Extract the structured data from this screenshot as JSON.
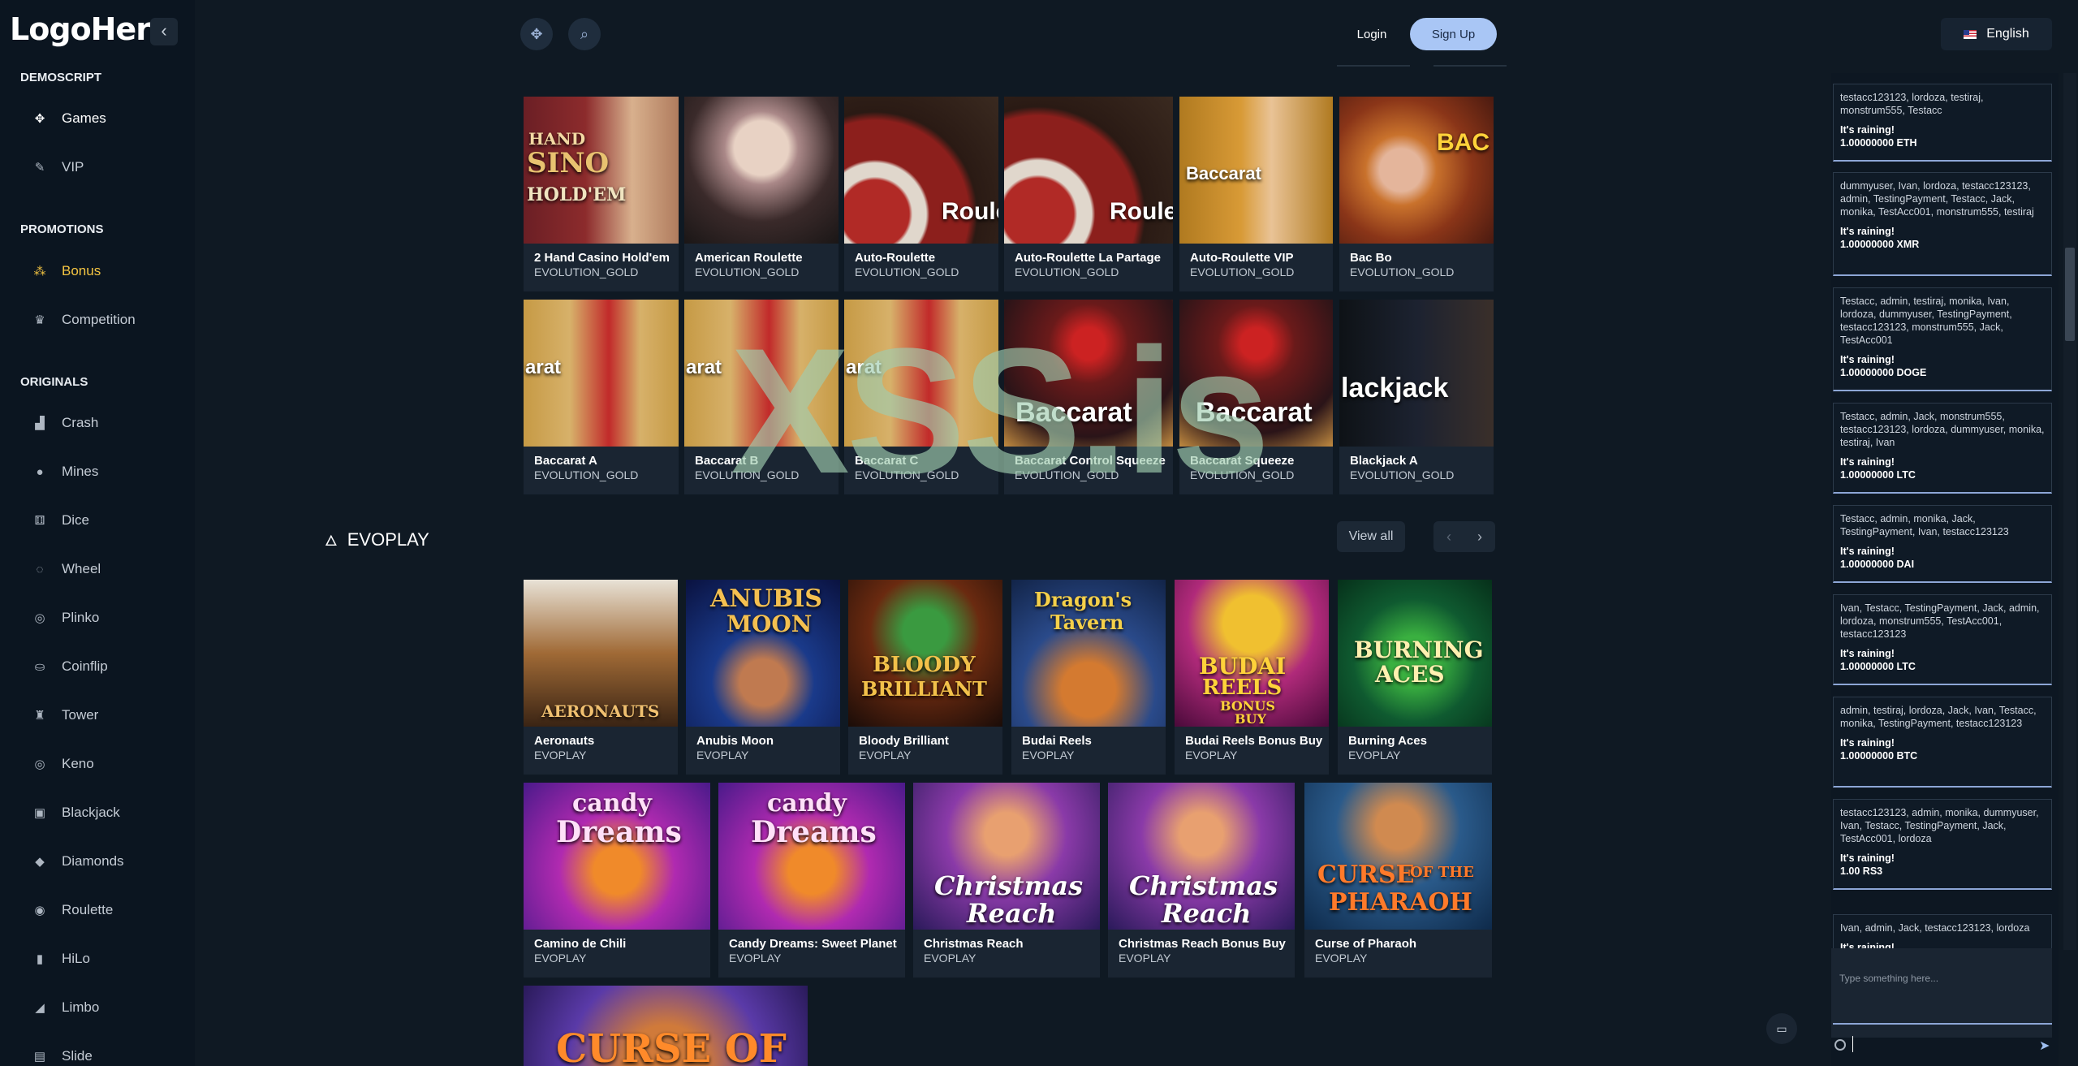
{
  "logo": "LogoHere",
  "sidebar": {
    "collapse_icon": "‹",
    "sections": [
      {
        "title": "DEMOSCRIPT",
        "items": [
          {
            "label": "Games",
            "icon": "games-icon"
          },
          {
            "label": "VIP",
            "icon": "vip-icon"
          }
        ]
      },
      {
        "title": "PROMOTIONS",
        "items": [
          {
            "label": "Bonus",
            "icon": "bonus-icon"
          },
          {
            "label": "Competition",
            "icon": "competition-icon"
          }
        ]
      },
      {
        "title": "ORIGINALS",
        "items": [
          {
            "label": "Crash"
          },
          {
            "label": "Mines"
          },
          {
            "label": "Dice"
          },
          {
            "label": "Wheel"
          },
          {
            "label": "Plinko"
          },
          {
            "label": "Coinflip"
          },
          {
            "label": "Tower"
          },
          {
            "label": "Keno"
          },
          {
            "label": "Blackjack"
          },
          {
            "label": "Diamonds"
          },
          {
            "label": "Roulette"
          },
          {
            "label": "HiLo"
          },
          {
            "label": "Limbo"
          },
          {
            "label": "Slide"
          }
        ]
      }
    ]
  },
  "header": {
    "login": "Login",
    "signup": "Sign Up",
    "language": "English"
  },
  "evolution": {
    "provider": "EVOLUTION_GOLD",
    "row1": [
      "2 Hand Casino Hold'em",
      "American Roulette",
      "Auto-Roulette",
      "Auto-Roulette La Partage",
      "Auto-Roulette VIP",
      "Bac Bo"
    ],
    "row2": [
      "Baccarat A",
      "Baccarat B",
      "Baccarat C",
      "Baccarat Control Squeeze",
      "Baccarat Squeeze",
      "Blackjack A"
    ]
  },
  "evoplay": {
    "title": "EVOPLAY",
    "view_all": "View all",
    "provider": "EVOPLAY",
    "row1": [
      "Aeronauts",
      "Anubis Moon",
      "Bloody Brilliant",
      "Budai Reels",
      "Budai Reels Bonus Buy",
      "Burning Aces"
    ],
    "row2": [
      "Camino de Chili",
      "Candy Dreams: Sweet Planet",
      "Christmas Reach",
      "Christmas Reach Bonus Buy",
      "Curse of Pharaoh"
    ]
  },
  "art_text": {
    "e1": [
      "HAND",
      "SINO",
      "HOLD'EM"
    ],
    "e3": "Roule",
    "e4": "Roule",
    "e5": "Baccarat",
    "e6": "BAC",
    "e7": "arat",
    "e10": "Baccarat",
    "e11": "Baccarat",
    "e12": "lackjack",
    "v1": "AERONAUTS",
    "v2": [
      "ANUBIS",
      "MOON"
    ],
    "v3": [
      "BLOODY",
      "BRILLIANT"
    ],
    "v4": [
      "Dragon's",
      "Tavern"
    ],
    "v5": [
      "BUDAI",
      "REELS",
      "BONUS",
      "BUY"
    ],
    "v6": [
      "BURNING",
      "ACES"
    ],
    "c1": [
      "candy",
      "Dreams"
    ],
    "c3": [
      "Christmas",
      "Reach"
    ],
    "c5": [
      "CURSE",
      "OF THE",
      "PHARAOH"
    ],
    "c6": "CURSE OF"
  },
  "watermark": "XSS.is",
  "chat": {
    "messages": [
      {
        "users": "testacc123123, lordoza, testiraj, monstrum555, Testacc",
        "rain": "It's raining!",
        "amount": "1.00000000 ETH"
      },
      {
        "users": "dummyuser, Ivan, lordoza, testacc123123, admin, TestingPayment, Testacc, Jack, monika, TestAcc001, monstrum555, testiraj",
        "rain": "It's raining!",
        "amount": "1.00000000 XMR"
      },
      {
        "users": "Testacc, admin, testiraj, monika, Ivan, lordoza, dummyuser, TestingPayment, testacc123123, monstrum555, Jack, TestAcc001",
        "rain": "It's raining!",
        "amount": "1.00000000 DOGE"
      },
      {
        "users": "Testacc, admin, Jack, monstrum555, testacc123123, lordoza, dummyuser, monika, testiraj, Ivan",
        "rain": "It's raining!",
        "amount": "1.00000000 LTC"
      },
      {
        "users": "Testacc, admin, monika, Jack, TestingPayment, Ivan, testacc123123",
        "rain": "It's raining!",
        "amount": "1.00000000 DAI"
      },
      {
        "users": "Ivan, Testacc, TestingPayment, Jack, admin, lordoza, monstrum555, TestAcc001, testacc123123",
        "rain": "It's raining!",
        "amount": "1.00000000 LTC"
      },
      {
        "users": "admin, testiraj, lordoza, Jack, Ivan, Testacc, monika, TestingPayment, testacc123123",
        "rain": "It's raining!",
        "amount": "1.00000000 BTC"
      },
      {
        "users": "testacc123123, admin, monika, dummyuser, Ivan, Testacc, TestingPayment, Jack, TestAcc001, lordoza",
        "rain": "It's raining!",
        "amount": "1.00 RS3"
      },
      {
        "users": "Ivan, admin, Jack, testacc123123, lordoza",
        "rain": "It's raining!",
        "amount": ""
      }
    ],
    "placeholder": "Type something here..."
  },
  "colors": {
    "accent": "#a9c6f5",
    "bonus": "#f5c542",
    "background": "#0f1923"
  }
}
